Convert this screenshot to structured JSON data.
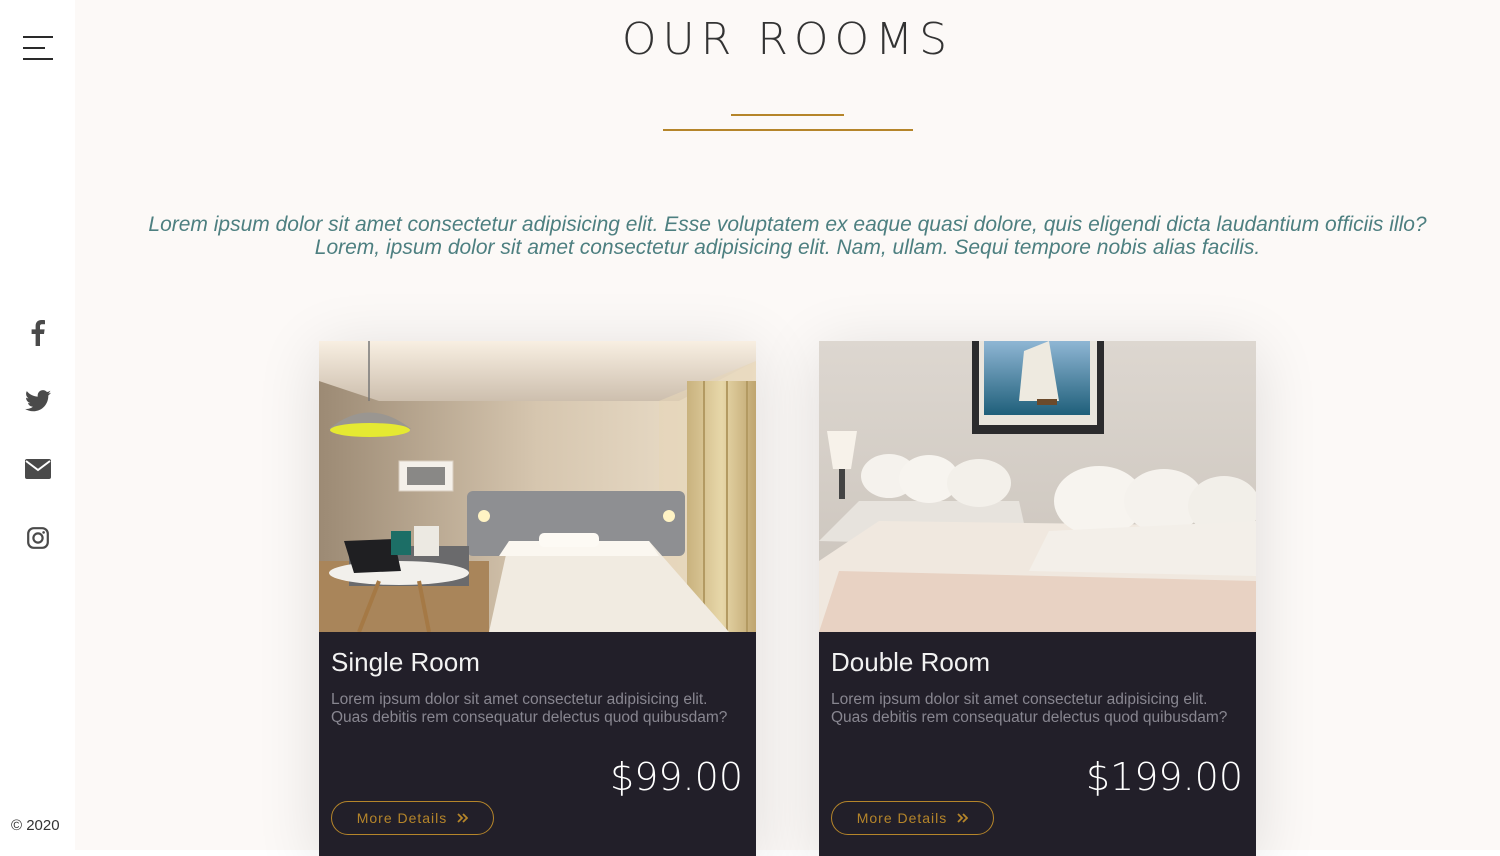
{
  "sidebar": {
    "menu_icon": "hamburger-menu-icon",
    "social": [
      {
        "name": "facebook",
        "icon": "facebook-icon"
      },
      {
        "name": "twitter",
        "icon": "twitter-icon"
      },
      {
        "name": "email",
        "icon": "envelope-icon"
      },
      {
        "name": "instagram",
        "icon": "instagram-icon"
      }
    ],
    "copyright": "© 2020"
  },
  "main": {
    "title": "OUR ROOMS",
    "intro": "Lorem ipsum dolor sit amet consectetur adipisicing elit. Esse voluptatem ex eaque quasi dolore, quis eligendi dicta laudantium officiis illo? Lorem, ipsum dolor sit amet consectetur adipisicing elit. Nam, ullam. Sequi tempore nobis alias facilis."
  },
  "rooms": [
    {
      "name": "Single Room",
      "description": "Lorem ipsum dolor sit amet consectetur adipisicing elit. Quas debitis rem consequatur delectus quod quibusdam?",
      "price": "$99.00",
      "button_label": "More Details"
    },
    {
      "name": "Double Room",
      "description": "Lorem ipsum dolor sit amet consectetur adipisicing elit. Quas debitis rem consequatur delectus quod quibusdam?",
      "price": "$199.00",
      "button_label": "More Details"
    }
  ],
  "colors": {
    "accent": "#b5852a",
    "card_bg": "#221f29",
    "intro_text": "#4d7f80",
    "page_bg": "#fcf9f7"
  }
}
